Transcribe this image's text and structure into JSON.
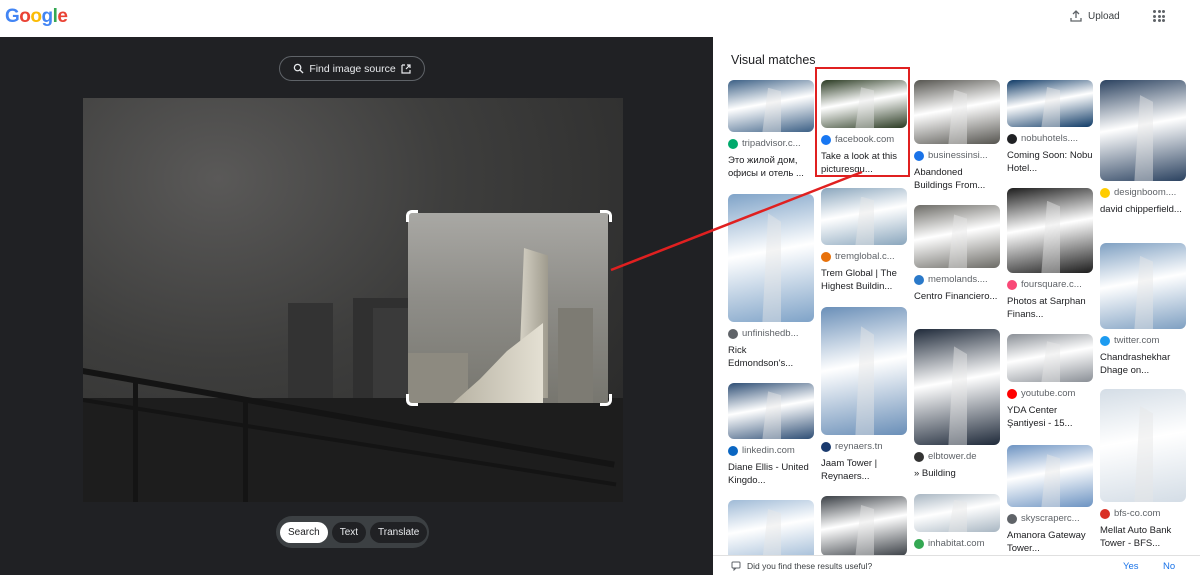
{
  "header": {
    "logo_letters": [
      "G",
      "o",
      "o",
      "g",
      "l",
      "e"
    ],
    "upload_label": "Upload",
    "apps_icon": "apps-grid-icon"
  },
  "left": {
    "find_source_label": "Find image source",
    "modes": [
      "Search",
      "Text",
      "Translate"
    ],
    "active_mode": "Search"
  },
  "right": {
    "title": "Visual matches",
    "feedback_question": "Did you find these results useful?",
    "yes": "Yes",
    "no": "No",
    "cards": [
      {
        "source": "tripadvisor.c...",
        "title": "Это жилой дом, офисы и отель ...",
        "fav": "#00aa6c",
        "th": "#3b5f85"
      },
      {
        "source": "unfinishedb...",
        "title": "Rick Edmondson's...",
        "fav": "#5f6368",
        "th": "#7fa3c8"
      },
      {
        "source": "linkedin.com",
        "title": "Diane Ellis - United Kingdo...",
        "fav": "#0a66c2",
        "th": "#2e4e75"
      },
      {
        "source": "",
        "title": "",
        "fav": "#5f6368",
        "th": "#9fbad6"
      },
      {
        "source": "facebook.com",
        "title": "Take a look at this picturesqu...",
        "fav": "#1877f2",
        "th": "#2a3a22"
      },
      {
        "source": "tremglobal.c...",
        "title": "Trem Global | The Highest Buildin...",
        "fav": "#e8710a",
        "th": "#8aa6bd"
      },
      {
        "source": "reynaers.tn",
        "title": "Jaam Tower | Reynaers...",
        "fav": "#1a3a6e",
        "th": "#6a8fb8"
      },
      {
        "source": "",
        "title": "",
        "fav": "#5f6368",
        "th": "#3a3f45"
      },
      {
        "source": "businessinsi...",
        "title": "Abandoned Buildings From...",
        "fav": "#1a73e8",
        "th": "#55544f"
      },
      {
        "source": "memolands....",
        "title": "Centro Financiero...",
        "fav": "#2a79c9",
        "th": "#6c6b66"
      },
      {
        "source": "elbtower.de",
        "title": "» Building",
        "fav": "#333333",
        "th": "#1f2a3a"
      },
      {
        "source": "inhabitat.com",
        "title": "",
        "fav": "#34a853",
        "th": "#a8b6c2"
      },
      {
        "source": "nobuhotels....",
        "title": "Coming Soon: Nobu Hotel...",
        "fav": "#202124",
        "th": "#0f3a66"
      },
      {
        "source": "foursquare.c...",
        "title": "Photos at Sarphan Finans...",
        "fav": "#f94877",
        "th": "#1c1c1c"
      },
      {
        "source": "youtube.com",
        "title": "YDA Center Şantiyesi - 15...",
        "fav": "#ff0000",
        "th": "#8a8f96"
      },
      {
        "source": "skyscraperc...",
        "title": "Amanora Gateway Tower...",
        "fav": "#5f6368",
        "th": "#6c93c2"
      },
      {
        "source": "designboom....",
        "title": "david chipperfield...",
        "fav": "#ffcc00",
        "th": "#2b4260"
      },
      {
        "source": "twitter.com",
        "title": "Chandrashekhar Dhage on...",
        "fav": "#1d9bf0",
        "th": "#7fa0c2"
      },
      {
        "source": "bfs-co.com",
        "title": "Mellat Auto Bank Tower - BFS...",
        "fav": "#d93025",
        "th": "#d4dde6"
      }
    ]
  }
}
